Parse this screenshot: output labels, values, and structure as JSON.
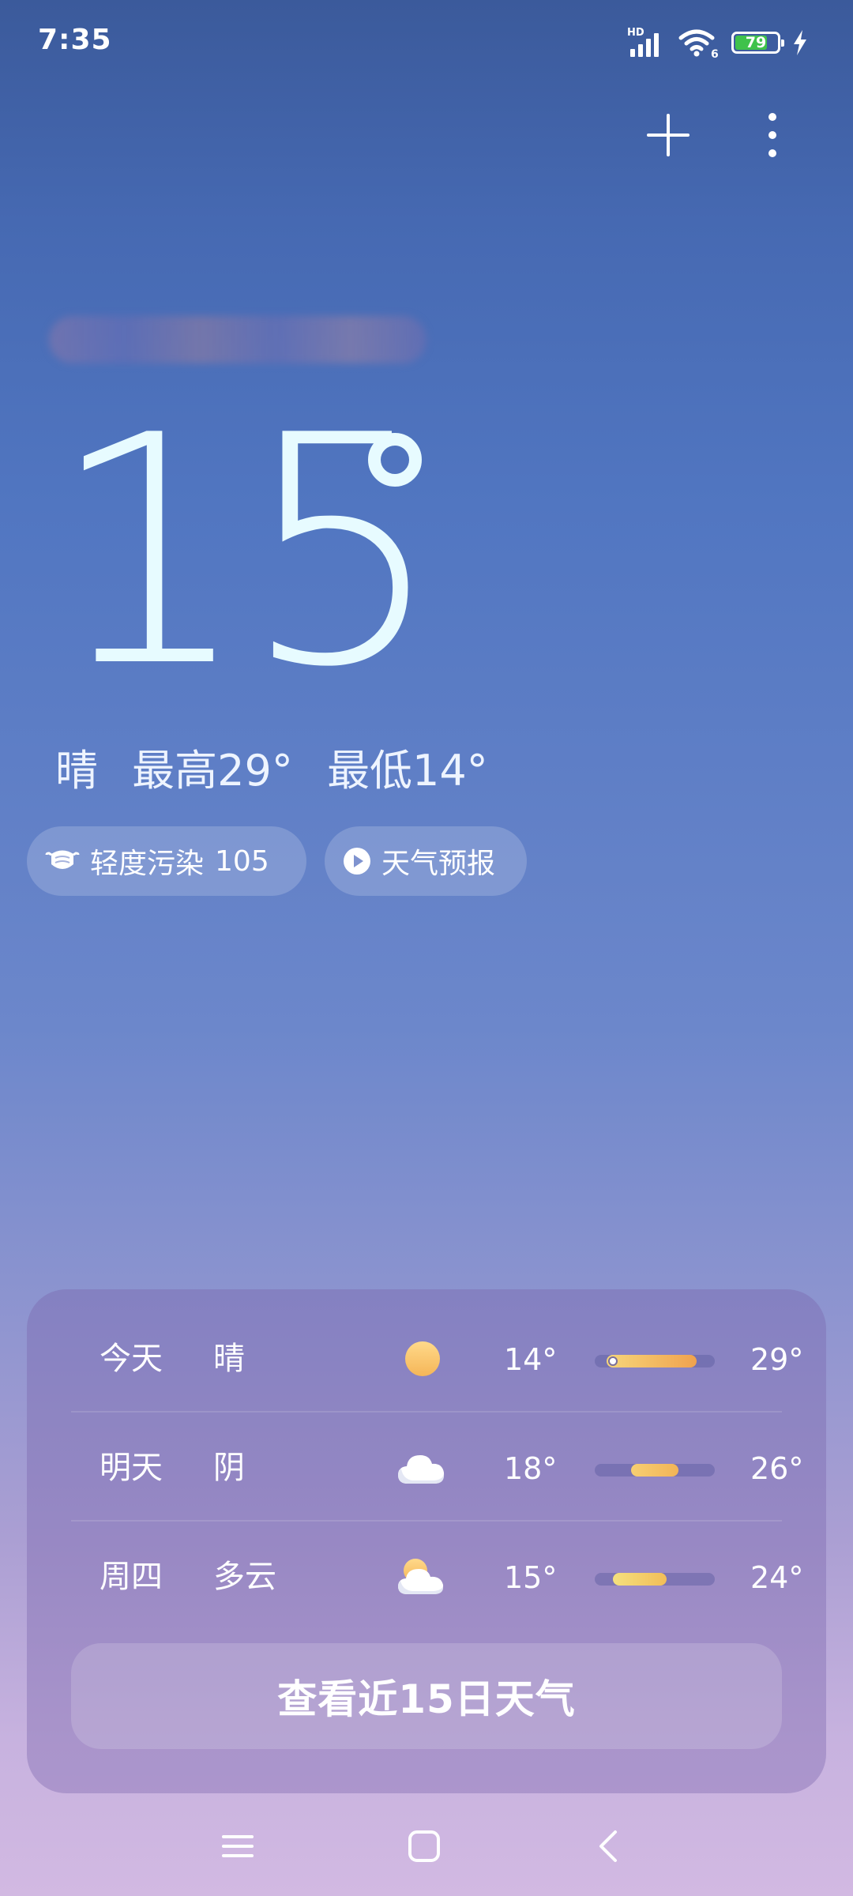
{
  "status_bar": {
    "time": "7:35",
    "network_badge": "HD",
    "wifi_badge": "6",
    "battery_level": "79",
    "battery_fraction": 0.79,
    "battery_color": "#3fc24b",
    "icons": [
      "signal-icon",
      "wifi-icon",
      "battery-icon",
      "charging-icon"
    ]
  },
  "toolbar": {
    "add_icon": "plus-icon",
    "more_icon": "more-vertical-icon"
  },
  "current": {
    "temperature": "15",
    "condition": "晴",
    "high": "最高29°",
    "low": "最低14°"
  },
  "chips": {
    "aqi_label": "轻度污染",
    "aqi_value": "105",
    "aqi_icon": "mask-icon",
    "forecast_label": "天气预报",
    "forecast_icon": "play-icon"
  },
  "forecast": {
    "days": [
      {
        "day": "今天",
        "condition": "晴",
        "icon": "sun-icon",
        "low": "14°",
        "high": "29°",
        "low_value": 14,
        "high_value": 29,
        "current_value": 15
      },
      {
        "day": "明天",
        "condition": "阴",
        "icon": "cloud-icon",
        "low": "18°",
        "high": "26°",
        "low_value": 18,
        "high_value": 26
      },
      {
        "day": "周四",
        "condition": "多云",
        "icon": "partly-cloudy-icon",
        "low": "15°",
        "high": "24°",
        "low_value": 15,
        "high_value": 24
      }
    ],
    "range_min": 12,
    "range_max": 32,
    "button_label": "查看近15日天气"
  },
  "nav": {
    "icons": [
      "menu-icon",
      "home-icon",
      "back-icon"
    ]
  }
}
